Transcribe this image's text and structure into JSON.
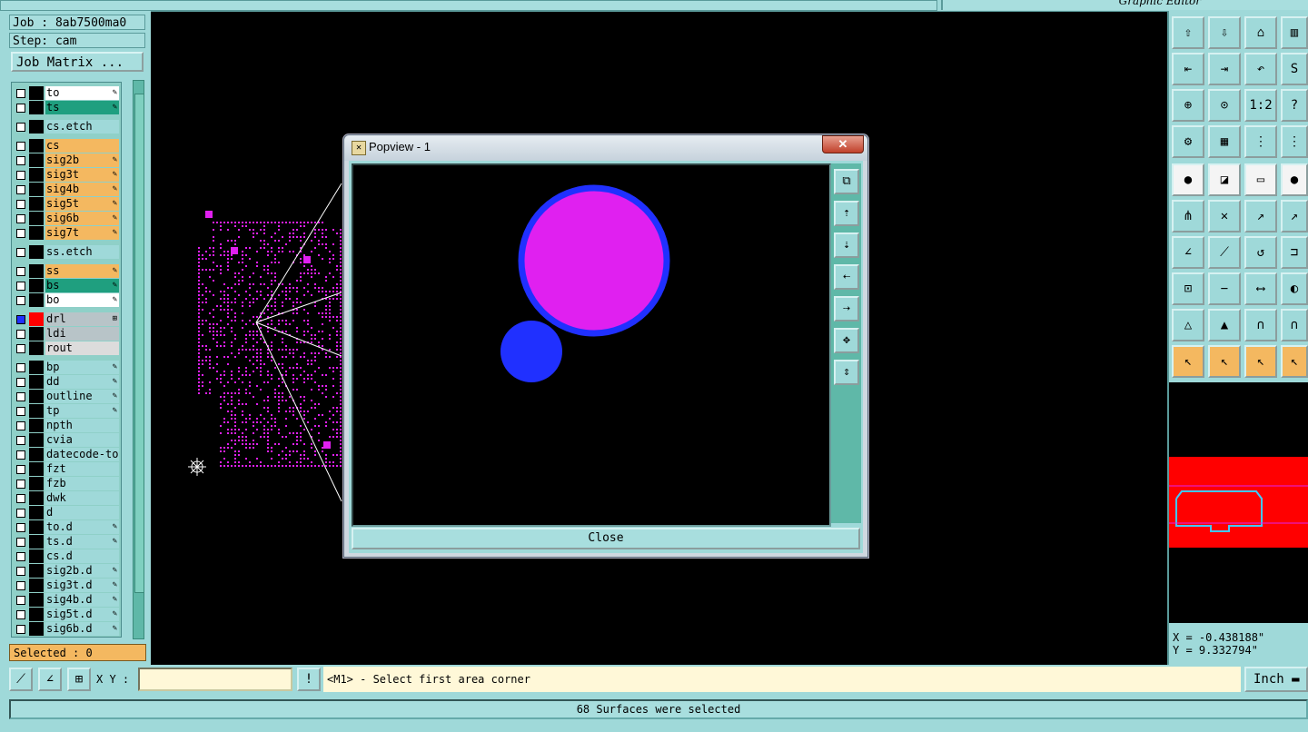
{
  "window": {
    "title": "Graphic Editor"
  },
  "job": {
    "job_label": "Job : 8ab7500ma0",
    "step_label": "Step: cam",
    "matrix_button": "Job Matrix ..."
  },
  "layers": [
    {
      "name": "to",
      "bg": "#ffffff",
      "mark": "✎"
    },
    {
      "name": "ts",
      "bg": "#1f9f7f",
      "mark": "✎"
    },
    {
      "name": "cs.etch",
      "bg": "#9fd9d9",
      "mark": ""
    },
    {
      "name": "cs",
      "bg": "#f4b860",
      "mark": ""
    },
    {
      "name": "sig2b",
      "bg": "#f4b860",
      "mark": "✎"
    },
    {
      "name": "sig3t",
      "bg": "#f4b860",
      "mark": "✎"
    },
    {
      "name": "sig4b",
      "bg": "#f4b860",
      "mark": "✎"
    },
    {
      "name": "sig5t",
      "bg": "#f4b860",
      "mark": "✎"
    },
    {
      "name": "sig6b",
      "bg": "#f4b860",
      "mark": "✎"
    },
    {
      "name": "sig7t",
      "bg": "#f4b860",
      "mark": "✎"
    },
    {
      "name": "ss.etch",
      "bg": "#9fd9d9",
      "mark": ""
    },
    {
      "name": "ss",
      "bg": "#f4b860",
      "mark": "✎"
    },
    {
      "name": "bs",
      "bg": "#1f9f7f",
      "mark": "✎"
    },
    {
      "name": "bo",
      "bg": "#ffffff",
      "mark": "✎"
    },
    {
      "name": "drl",
      "bg": "#b8c4c8",
      "mark": "⊞",
      "active": true
    },
    {
      "name": "ldi",
      "bg": "#b8c4c8",
      "mark": ""
    },
    {
      "name": "rout",
      "bg": "#dcdcdc",
      "mark": ""
    },
    {
      "name": "bp",
      "bg": "#9fd9d9",
      "mark": "✎"
    },
    {
      "name": "dd",
      "bg": "#9fd9d9",
      "mark": "✎"
    },
    {
      "name": "outline",
      "bg": "#9fd9d9",
      "mark": "✎"
    },
    {
      "name": "tp",
      "bg": "#9fd9d9",
      "mark": "✎"
    },
    {
      "name": "npth",
      "bg": "#9fd9d9",
      "mark": ""
    },
    {
      "name": "cvia",
      "bg": "#9fd9d9",
      "mark": ""
    },
    {
      "name": "datecode-to",
      "bg": "#9fd9d9",
      "mark": ""
    },
    {
      "name": "fzt",
      "bg": "#9fd9d9",
      "mark": ""
    },
    {
      "name": "fzb",
      "bg": "#9fd9d9",
      "mark": ""
    },
    {
      "name": "dwk",
      "bg": "#9fd9d9",
      "mark": ""
    },
    {
      "name": "d",
      "bg": "#9fd9d9",
      "mark": ""
    },
    {
      "name": "to.d",
      "bg": "#9fd9d9",
      "mark": "✎"
    },
    {
      "name": "ts.d",
      "bg": "#9fd9d9",
      "mark": "✎"
    },
    {
      "name": "cs.d",
      "bg": "#9fd9d9",
      "mark": ""
    },
    {
      "name": "sig2b.d",
      "bg": "#9fd9d9",
      "mark": "✎"
    },
    {
      "name": "sig3t.d",
      "bg": "#9fd9d9",
      "mark": "✎"
    },
    {
      "name": "sig4b.d",
      "bg": "#9fd9d9",
      "mark": "✎"
    },
    {
      "name": "sig5t.d",
      "bg": "#9fd9d9",
      "mark": "✎"
    },
    {
      "name": "sig6b.d",
      "bg": "#9fd9d9",
      "mark": "✎"
    }
  ],
  "selected_label": "Selected : 0",
  "popview": {
    "title": "Popview - 1",
    "close_label": "Close",
    "close_x": "✕"
  },
  "coords": {
    "x": "X = -0.438188\"",
    "y": "Y = 9.332794\""
  },
  "command": {
    "xy_label": "X Y :",
    "xy_value": "",
    "bang": "!",
    "prompt": "<M1> - Select first area corner",
    "units": "Inch"
  },
  "status": "68 Surfaces were selected",
  "colors": {
    "panel": "#9fd9d9",
    "surface": "#e020f0",
    "pad_outline": "#2030ff",
    "overview_fill": "#ff0000"
  }
}
